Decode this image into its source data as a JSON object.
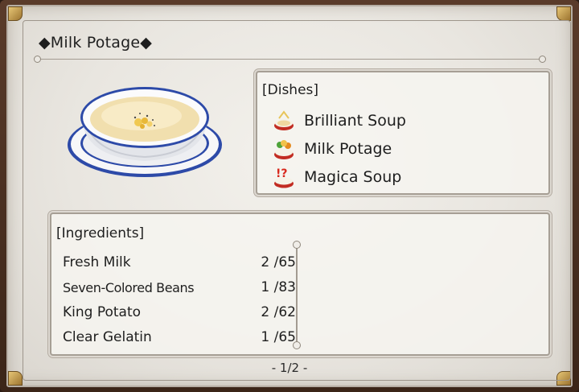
{
  "recipe": {
    "title": "◆Milk Potage◆"
  },
  "dishes": {
    "heading": "[Dishes]",
    "items": [
      {
        "label": "Brilliant Soup",
        "icon": "brilliant-soup-icon"
      },
      {
        "label": "Milk Potage",
        "icon": "milk-potage-icon"
      },
      {
        "label": "Magica Soup",
        "icon": "magica-soup-icon"
      }
    ]
  },
  "ingredients": {
    "heading": "[Ingredients]",
    "items": [
      {
        "name": "Fresh Milk",
        "count": "2 /65"
      },
      {
        "name": "Seven-Colored Beans",
        "count": "1 /83"
      },
      {
        "name": "King Potato",
        "count": "2 /62"
      },
      {
        "name": "Clear Gelatin",
        "count": "1 /65"
      }
    ]
  },
  "pagination": {
    "label": "- 1/2 -"
  },
  "colors": {
    "frame": "#4a3020",
    "parchment": "#ecE9e3",
    "text": "#1e1e1e",
    "bowl_rim": "#2a46a0",
    "soup": "#f1dfae"
  }
}
